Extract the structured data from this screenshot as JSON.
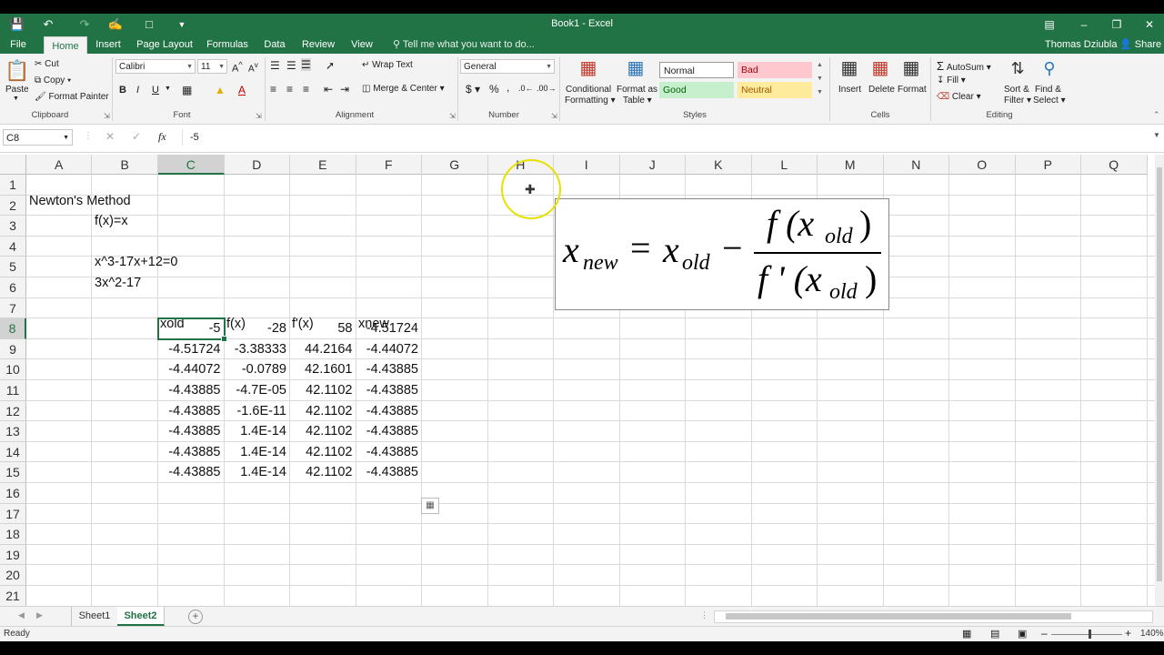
{
  "title_bar": {
    "title": "Book1 - Excel",
    "qat": [
      "save-icon",
      "undo-icon",
      "redo-icon",
      "touch-mode-icon",
      "print-preview-icon",
      "customize-qat-icon"
    ]
  },
  "tabs": [
    "File",
    "Home",
    "Insert",
    "Page Layout",
    "Formulas",
    "Data",
    "Review",
    "View"
  ],
  "tell_me": "Tell me what you want to do...",
  "user": "Thomas Dziubla",
  "share": "Share",
  "ribbon": {
    "clipboard": {
      "paste": "Paste",
      "cut": "Cut",
      "copy": "Copy",
      "format_painter": "Format Painter",
      "label": "Clipboard"
    },
    "font": {
      "name": "Calibri",
      "size": "11",
      "bold": "B",
      "italic": "I",
      "underline": "U",
      "label": "Font"
    },
    "alignment": {
      "wrap": "Wrap Text",
      "merge": "Merge & Center",
      "label": "Alignment"
    },
    "number": {
      "format": "General",
      "currency": "$",
      "percent": "%",
      "comma": ",",
      "label": "Number"
    },
    "styles": {
      "conditional": "Conditional",
      "formatting": "Formatting",
      "format_as": "Format as",
      "table": "Table",
      "normal": "Normal",
      "bad": "Bad",
      "good": "Good",
      "neutral": "Neutral",
      "label": "Styles"
    },
    "cells": {
      "insert": "Insert",
      "delete": "Delete",
      "format": "Format",
      "label": "Cells"
    },
    "editing": {
      "autosum": "AutoSum",
      "fill": "Fill",
      "clear": "Clear",
      "sort": "Sort &",
      "filter": "Filter",
      "find": "Find &",
      "select": "Select",
      "label": "Editing"
    }
  },
  "formula_bar": {
    "name_box": "C8",
    "fx": "fx",
    "content": "-5"
  },
  "columns": [
    "A",
    "B",
    "C",
    "D",
    "E",
    "F",
    "G",
    "H",
    "I",
    "J",
    "K",
    "L",
    "M",
    "N",
    "O",
    "P",
    "Q"
  ],
  "rows": [
    "1",
    "2",
    "3",
    "4",
    "5",
    "6",
    "7",
    "8",
    "9",
    "10",
    "11",
    "12",
    "13",
    "14",
    "15",
    "16",
    "17",
    "18",
    "19",
    "20",
    "21"
  ],
  "cells": {
    "A1": "Newton's Method",
    "B2": "f(x)=x",
    "B4": "x^3-17x+12=0",
    "B5": "3x^2-17",
    "C7": "xold",
    "D7": "f(x)",
    "E7": "f'(x)",
    "F7": "xnew",
    "table": [
      [
        "-5",
        "-28",
        "58",
        "-4.51724"
      ],
      [
        "-4.51724",
        "-3.38333",
        "44.2164",
        "-4.44072"
      ],
      [
        "-4.44072",
        "-0.0789",
        "42.1601",
        "-4.43885"
      ],
      [
        "-4.43885",
        "-4.7E-05",
        "42.1102",
        "-4.43885"
      ],
      [
        "-4.43885",
        "-1.6E-11",
        "42.1102",
        "-4.43885"
      ],
      [
        "-4.43885",
        "1.4E-14",
        "42.1102",
        "-4.43885"
      ],
      [
        "-4.43885",
        "1.4E-14",
        "42.1102",
        "-4.43885"
      ],
      [
        "-4.43885",
        "1.4E-14",
        "42.1102",
        "-4.43885"
      ]
    ]
  },
  "formula_image": {
    "x": "x",
    "new": "new",
    "eq": "=",
    "old": "old",
    "minus": "−",
    "numer": "f (x",
    "numer_close": ")",
    "denom": "f ' (x",
    "denom_close": ")"
  },
  "sheets": [
    "Sheet1",
    "Sheet2"
  ],
  "active_sheet": "Sheet2",
  "status": {
    "ready": "Ready",
    "zoom": "140%"
  },
  "colors": {
    "accent": "#217346",
    "bad_bg": "#ffc7ce",
    "good_bg": "#c6efce",
    "neutral_bg": "#ffeb9c"
  }
}
